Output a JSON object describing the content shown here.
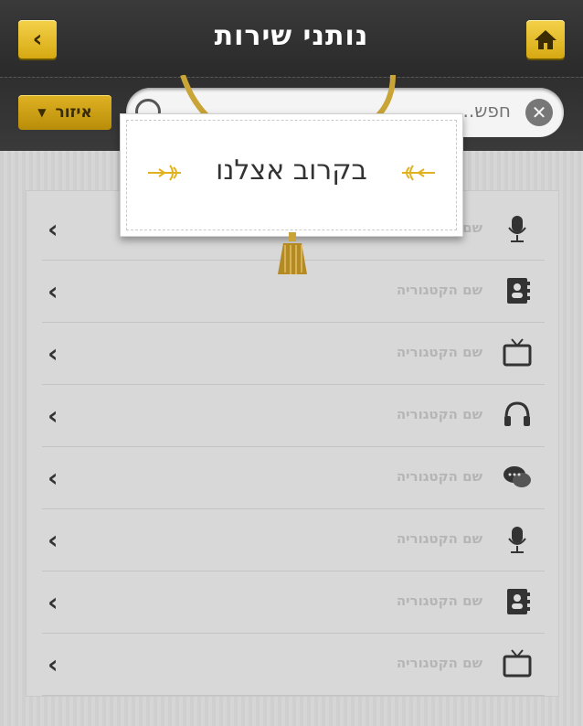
{
  "header": {
    "title": "נותני שירות",
    "back_icon": "chevron-left-icon",
    "home_icon": "home-icon"
  },
  "filter": {
    "label": "איזור"
  },
  "search": {
    "placeholder": "חפש..."
  },
  "sign": {
    "text": "בקרוב אצלנו"
  },
  "categories": [
    {
      "label": "שם הקטגוריה",
      "icon": "microphone-icon"
    },
    {
      "label": "שם הקטגוריה",
      "icon": "contacts-icon"
    },
    {
      "label": "שם הקטגוריה",
      "icon": "tv-icon"
    },
    {
      "label": "שם הקטגוריה",
      "icon": "headphones-icon"
    },
    {
      "label": "שם הקטגוריה",
      "icon": "chat-icon"
    },
    {
      "label": "שם הקטגוריה",
      "icon": "microphone-icon"
    },
    {
      "label": "שם הקטגוריה",
      "icon": "contacts-icon"
    },
    {
      "label": "שם הקטגוריה",
      "icon": "tv-icon"
    }
  ],
  "colors": {
    "accent": "#e8bb20",
    "header_bg": "#333333"
  }
}
